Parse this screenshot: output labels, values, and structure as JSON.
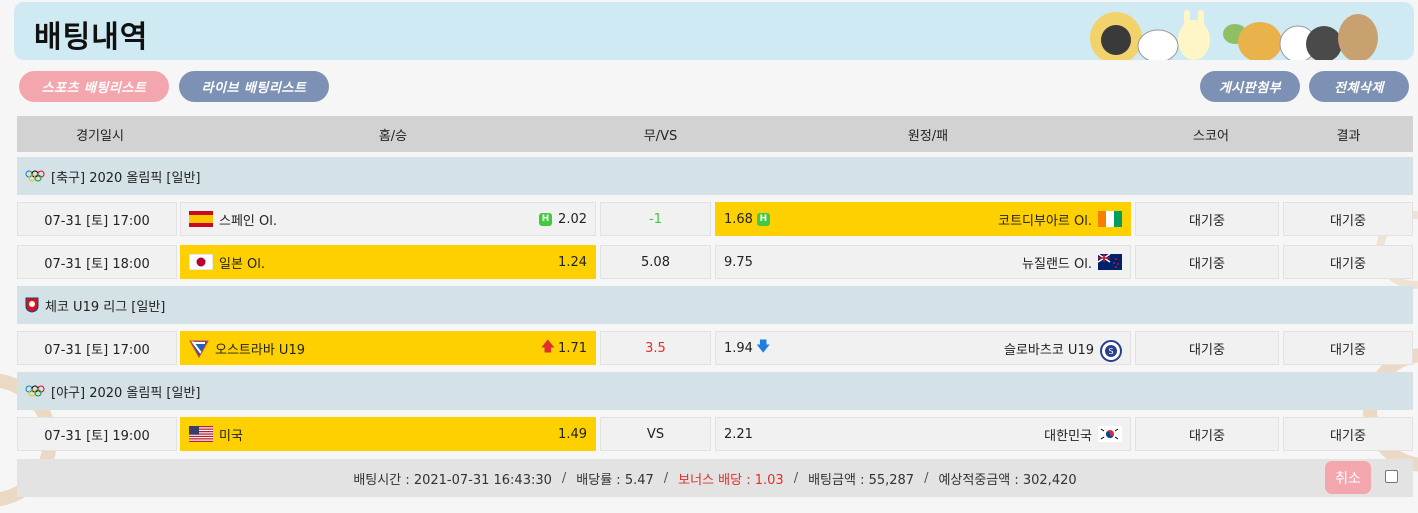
{
  "page": {
    "title": "배팅내역"
  },
  "tabs": {
    "sports": "스포츠 배팅리스트",
    "live": "라이브 배팅리스트",
    "attach": "게시판첨부",
    "delete_all": "전체삭제"
  },
  "columns": [
    "경기일시",
    "홈/승",
    "무/VS",
    "원정/패",
    "스코어",
    "결과"
  ],
  "leagues": [
    {
      "name": "[축구] 2020 올림픽 [일반]",
      "icon": "olympic-rings-icon"
    },
    {
      "name": "체코 U19 리그 [일반]",
      "icon": "czech-league-icon"
    },
    {
      "name": "[야구] 2020 올림픽 [일반]",
      "icon": "olympic-rings-icon"
    }
  ],
  "matches": [
    {
      "datetime": "07-31 [토] 17:00",
      "home": "스페인 Ol.",
      "home_odd": "2.02",
      "home_mark": "H",
      "draw": "-1",
      "away_odd": "1.68",
      "away_mark": "H",
      "away": "코트디부아르 Ol.",
      "score": "대기중",
      "result": "대기중",
      "selected": "away"
    },
    {
      "datetime": "07-31 [토] 18:00",
      "home": "일본 Ol.",
      "home_odd": "1.24",
      "draw": "5.08",
      "away_odd": "9.75",
      "away": "뉴질랜드 Ol.",
      "score": "대기중",
      "result": "대기중",
      "selected": "home"
    },
    {
      "datetime": "07-31 [토] 17:00",
      "home": "오스트라바 U19",
      "home_odd": "1.71",
      "home_trend": "up-arrow-icon",
      "draw": "3.5",
      "away_odd": "1.94",
      "away_trend": "down-arrow-icon",
      "away": "슬로바츠코 U19",
      "score": "대기중",
      "result": "대기중",
      "selected": "home"
    },
    {
      "datetime": "07-31 [토] 19:00",
      "home": "미국",
      "home_odd": "1.49",
      "draw": "VS",
      "away_odd": "2.21",
      "away": "대한민국",
      "score": "대기중",
      "result": "대기중",
      "selected": "home"
    }
  ],
  "summary": {
    "bet_time": "배팅시간 : 2021-07-31 16:43:30",
    "rate": "배당률 : 5.47",
    "bonus": "보너스 배당 : 1.03",
    "amount": "배팅금액 : 55,287",
    "expected": "예상적중금액 : 302,420",
    "separator": "/"
  },
  "cancel_label": "취소",
  "colors": {
    "selected": "#ffd000",
    "header_bg": "#cfeaf3",
    "draw_negative": "#3fca3f",
    "draw_up": "#e0302a",
    "bonus": "#e0302a"
  }
}
